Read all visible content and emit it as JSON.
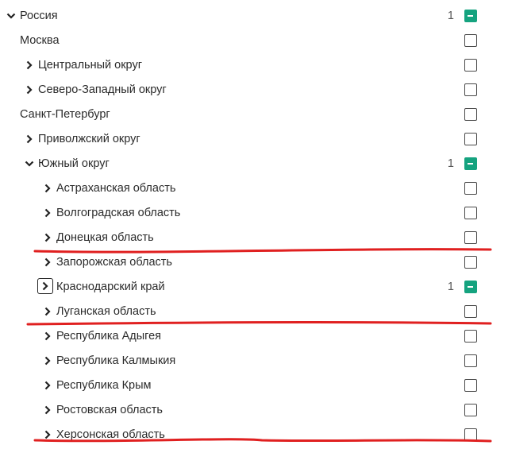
{
  "tree": {
    "root": {
      "label": "Россия",
      "count": "1",
      "expanded": true,
      "state": "partial"
    },
    "items": [
      {
        "label": "Москва",
        "state": "unchecked"
      },
      {
        "label": "Центральный округ",
        "state": "unchecked"
      },
      {
        "label": "Северо-Западный округ",
        "state": "unchecked"
      },
      {
        "label": "Санкт-Петербург",
        "state": "unchecked"
      },
      {
        "label": "Приволжский округ",
        "state": "unchecked"
      },
      {
        "label": "Южный округ",
        "count": "1",
        "expanded": true,
        "state": "partial"
      },
      {
        "label": "Астраханская область",
        "state": "unchecked"
      },
      {
        "label": "Волгоградская область",
        "state": "unchecked"
      },
      {
        "label": "Донецкая область",
        "state": "unchecked"
      },
      {
        "label": "Запорожская область",
        "state": "unchecked"
      },
      {
        "label": "Краснодарский край",
        "count": "1",
        "state": "partial",
        "focused": true
      },
      {
        "label": "Луганская область",
        "state": "unchecked"
      },
      {
        "label": "Республика Адыгея",
        "state": "unchecked"
      },
      {
        "label": "Республика Калмыкия",
        "state": "unchecked"
      },
      {
        "label": "Республика Крым",
        "state": "unchecked"
      },
      {
        "label": "Ростовская область",
        "state": "unchecked"
      },
      {
        "label": "Херсонская область",
        "state": "unchecked"
      }
    ]
  },
  "colors": {
    "accent": "#15a37f",
    "annotation": "#e02020"
  }
}
